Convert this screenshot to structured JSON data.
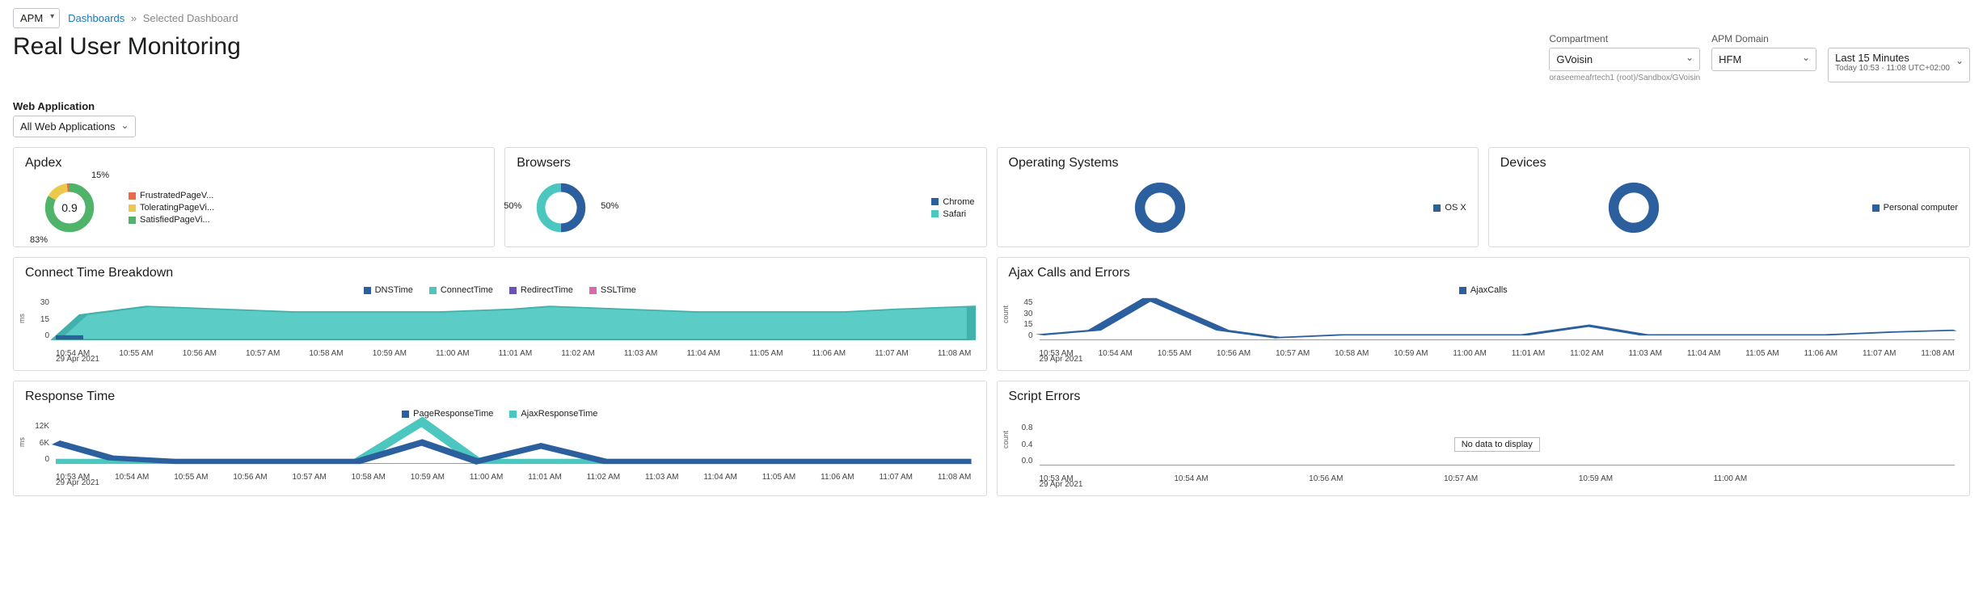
{
  "top": {
    "service_select": "APM",
    "breadcrumb_root": "Dashboards",
    "breadcrumb_current": "Selected Dashboard"
  },
  "page_title": "Real User Monitoring",
  "filters": {
    "compartment": {
      "label": "Compartment",
      "value": "GVoisin",
      "path": "oraseemeafrtech1 (root)/Sandbox/GVoisin"
    },
    "apm_domain": {
      "label": "APM Domain",
      "value": "HFM"
    },
    "time": {
      "main": "Last 15 Minutes",
      "sub": "Today 10:53 - 11:08 UTC+02:00"
    }
  },
  "web_app": {
    "label": "Web Application",
    "value": "All Web Applications"
  },
  "cards": {
    "apdex": {
      "title": "Apdex",
      "center": "0.9",
      "labels": {
        "top": "15%",
        "bottom": "83%"
      },
      "legend": [
        {
          "name": "FrustratedPageV...",
          "color": "#e86c4a"
        },
        {
          "name": "ToleratingPageVi...",
          "color": "#ecc94b"
        },
        {
          "name": "SatisfiedPageVi...",
          "color": "#4fb36a"
        }
      ]
    },
    "browsers": {
      "title": "Browsers",
      "labels": {
        "left": "50%",
        "right": "50%"
      },
      "legend": [
        {
          "name": "Chrome",
          "color": "#2b5f9e"
        },
        {
          "name": "Safari",
          "color": "#4bc7c0"
        }
      ]
    },
    "os": {
      "title": "Operating Systems",
      "legend": [
        {
          "name": "OS X",
          "color": "#2b5f9e"
        }
      ]
    },
    "devices": {
      "title": "Devices",
      "legend": [
        {
          "name": "Personal computer",
          "color": "#2b5f9e"
        }
      ]
    },
    "connect": {
      "title": "Connect Time Breakdown",
      "ylabel": "ms",
      "legend": [
        {
          "name": "DNSTime",
          "color": "#2b5f9e"
        },
        {
          "name": "ConnectTime",
          "color": "#4bc7c0"
        },
        {
          "name": "RedirectTime",
          "color": "#6b53b4"
        },
        {
          "name": "SSLTime",
          "color": "#d86aa8"
        }
      ]
    },
    "ajax": {
      "title": "Ajax Calls and Errors",
      "ylabel": "count",
      "legend": [
        {
          "name": "AjaxCalls",
          "color": "#2b5f9e"
        }
      ]
    },
    "response": {
      "title": "Response Time",
      "ylabel": "ms",
      "legend": [
        {
          "name": "PageResponseTime",
          "color": "#2b5f9e"
        },
        {
          "name": "AjaxResponseTime",
          "color": "#4bc7c0"
        }
      ]
    },
    "script": {
      "title": "Script Errors",
      "ylabel": "count",
      "nodata": "No data to display"
    }
  },
  "axes": {
    "date": "29 Apr 2021",
    "left_x": [
      "10:54 AM",
      "10:55 AM",
      "10:56 AM",
      "10:57 AM",
      "10:58 AM",
      "10:59 AM",
      "11:00 AM",
      "11:01 AM",
      "11:02 AM",
      "11:03 AM",
      "11:04 AM",
      "11:05 AM",
      "11:06 AM",
      "11:07 AM",
      "11:08 AM"
    ],
    "left_x_first": "10:53 AM",
    "right_x": [
      "10:53 AM",
      "10:54 AM",
      "10:55 AM",
      "10:56 AM",
      "10:57 AM",
      "10:58 AM",
      "10:59 AM",
      "11:00 AM",
      "11:01 AM",
      "11:02 AM",
      "11:03 AM",
      "11:04 AM",
      "11:05 AM",
      "11:06 AM",
      "11:07 AM",
      "11:08 AM"
    ],
    "script_x": [
      "10:53 AM",
      "10:54 AM",
      "10:56 AM",
      "10:57 AM",
      "10:59 AM",
      "11:00 AM"
    ],
    "connect_y": [
      "30",
      "15",
      "0"
    ],
    "ajax_y": [
      "45",
      "30",
      "15",
      "0"
    ],
    "response_y": [
      "12K",
      "6K",
      "0"
    ],
    "script_y": [
      "0.8",
      "0.4",
      "0.0"
    ]
  },
  "chart_data": {
    "apdex": {
      "type": "pie",
      "series": [
        {
          "name": "FrustratedPageViews",
          "value": 2
        },
        {
          "name": "ToleratingPageViews",
          "value": 15
        },
        {
          "name": "SatisfiedPageViews",
          "value": 83
        }
      ],
      "center_value": 0.9
    },
    "browsers": {
      "type": "pie",
      "series": [
        {
          "name": "Chrome",
          "value": 50
        },
        {
          "name": "Safari",
          "value": 50
        }
      ]
    },
    "os": {
      "type": "pie",
      "series": [
        {
          "name": "OS X",
          "value": 100
        }
      ]
    },
    "devices": {
      "type": "pie",
      "series": [
        {
          "name": "Personal computer",
          "value": 100
        }
      ]
    },
    "connect": {
      "type": "area",
      "x": [
        "10:53",
        "10:54",
        "10:55",
        "10:56",
        "10:57",
        "10:58",
        "10:59",
        "11:00",
        "11:01",
        "11:02",
        "11:03",
        "11:04",
        "11:05",
        "11:06",
        "11:07",
        "11:08"
      ],
      "series": [
        {
          "name": "ConnectTime",
          "values": [
            0,
            18,
            24,
            22,
            20,
            20,
            20,
            22,
            24,
            22,
            20,
            20,
            20,
            20,
            22,
            24
          ]
        },
        {
          "name": "DNSTime",
          "values": [
            0,
            1,
            1,
            1,
            1,
            1,
            1,
            1,
            2,
            1,
            1,
            1,
            1,
            1,
            1,
            1
          ]
        },
        {
          "name": "RedirectTime",
          "values": [
            0,
            0,
            0,
            0,
            0,
            0,
            0,
            0,
            0,
            0,
            0,
            0,
            0,
            0,
            0,
            0
          ]
        },
        {
          "name": "SSLTime",
          "values": [
            0,
            0,
            0,
            0,
            0,
            0,
            0,
            0,
            0,
            0,
            0,
            0,
            0,
            0,
            0,
            0
          ]
        }
      ],
      "ylabel": "ms",
      "ylim": [
        0,
        30
      ]
    },
    "ajax": {
      "type": "line",
      "x": [
        "10:53",
        "10:54",
        "10:55",
        "10:56",
        "10:57",
        "10:58",
        "10:59",
        "11:00",
        "11:01",
        "11:02",
        "11:03",
        "11:04",
        "11:05",
        "11:06",
        "11:07",
        "11:08"
      ],
      "series": [
        {
          "name": "AjaxCalls",
          "values": [
            5,
            10,
            45,
            10,
            2,
            5,
            5,
            5,
            5,
            15,
            5,
            5,
            5,
            5,
            8,
            10
          ]
        }
      ],
      "ylabel": "count",
      "ylim": [
        0,
        45
      ]
    },
    "response": {
      "type": "line",
      "x": [
        "10:53",
        "10:54",
        "10:55",
        "10:56",
        "10:57",
        "10:58",
        "10:59",
        "11:00",
        "11:01",
        "11:02",
        "11:03",
        "11:04",
        "11:05",
        "11:06",
        "11:07",
        "11:08"
      ],
      "series": [
        {
          "name": "PageResponseTime",
          "values": [
            6000,
            1500,
            500,
            500,
            500,
            500,
            6000,
            500,
            5000,
            500,
            500,
            500,
            500,
            500,
            500,
            500
          ]
        },
        {
          "name": "AjaxResponseTime",
          "values": [
            500,
            500,
            500,
            500,
            500,
            500,
            12000,
            500,
            500,
            500,
            500,
            500,
            500,
            500,
            500,
            500
          ]
        }
      ],
      "ylabel": "ms",
      "ylim": [
        0,
        12000
      ]
    },
    "script": {
      "type": "line",
      "x": [
        "10:53",
        "10:54",
        "10:56",
        "10:57",
        "10:59",
        "11:00"
      ],
      "series": [],
      "ylabel": "count",
      "ylim": [
        0,
        0.8
      ],
      "annotation": "No data to display"
    }
  }
}
